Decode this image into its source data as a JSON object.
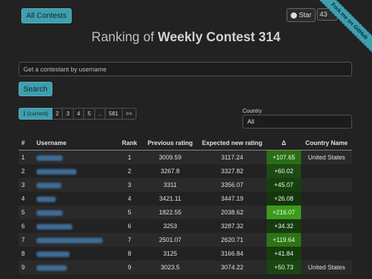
{
  "nav": {
    "all_contests": "All Contests"
  },
  "github": {
    "star_label": "Star",
    "star_count": "43",
    "ribbon": "Fork me on GitHub"
  },
  "title": {
    "prefix": "Ranking of",
    "contest": "Weekly Contest 314"
  },
  "search": {
    "placeholder": "Get a contestant by username",
    "button": "Search"
  },
  "pager": [
    "1 (current)",
    "2",
    "3",
    "4",
    "5",
    "..",
    "581",
    ">>"
  ],
  "country_filter": {
    "label": "Country",
    "value": "All"
  },
  "table": {
    "headers": [
      "#",
      "Username",
      "Rank",
      "Previous rating",
      "Expected new rating",
      "Δ",
      "Country Name"
    ],
    "rows": [
      {
        "num": "1",
        "rank": "1",
        "prev": "3009.59",
        "next": "3117.24",
        "delta": "+107.65",
        "country": "United States",
        "delta_color": "#2a6e14"
      },
      {
        "num": "2",
        "rank": "2",
        "prev": "3267.8",
        "next": "3327.82",
        "delta": "+60.02",
        "country": "",
        "delta_color": "#1c4a12"
      },
      {
        "num": "3",
        "rank": "3",
        "prev": "3311",
        "next": "3356.07",
        "delta": "+45.07",
        "country": "",
        "delta_color": "#18400f"
      },
      {
        "num": "4",
        "rank": "4",
        "prev": "3421.11",
        "next": "3447.19",
        "delta": "+26.08",
        "country": "",
        "delta_color": "#14360c"
      },
      {
        "num": "5",
        "rank": "5",
        "prev": "1822.55",
        "next": "2038.62",
        "delta": "+216.07",
        "country": "",
        "delta_color": "#3d9a1c"
      },
      {
        "num": "6",
        "rank": "6",
        "prev": "3253",
        "next": "3287.32",
        "delta": "+34.32",
        "country": "",
        "delta_color": "#163a0e"
      },
      {
        "num": "7",
        "rank": "7",
        "prev": "2501.07",
        "next": "2620.71",
        "delta": "+119.64",
        "country": "",
        "delta_color": "#2d7416"
      },
      {
        "num": "8",
        "rank": "8",
        "prev": "3125",
        "next": "3166.84",
        "delta": "+41.84",
        "country": "",
        "delta_color": "#173d0f"
      },
      {
        "num": "9",
        "rank": "9",
        "prev": "3023.5",
        "next": "3074.22",
        "delta": "+50.73",
        "country": "United States",
        "delta_color": "#1b4511"
      }
    ]
  }
}
